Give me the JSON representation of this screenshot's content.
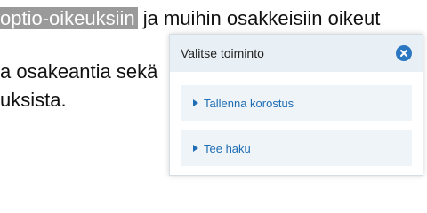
{
  "document": {
    "line1_highlight": "optio-oikeuksiin",
    "line1_rest": " ja muihin osakkeisiin oikeut",
    "line2": "a osakeantia sekä",
    "line3": "uksista."
  },
  "popup": {
    "title": "Valitse toiminto",
    "close_icon": "close-icon",
    "items": [
      {
        "label": "Tallenna korostus",
        "icon": "triangle-right-icon"
      },
      {
        "label": "Tee haku",
        "icon": "triangle-right-icon"
      }
    ]
  },
  "colors": {
    "highlight": "#9a9a9a",
    "accent": "#1f6db4",
    "header_bg": "#e8f0f5",
    "item_bg": "#eef4f7"
  }
}
